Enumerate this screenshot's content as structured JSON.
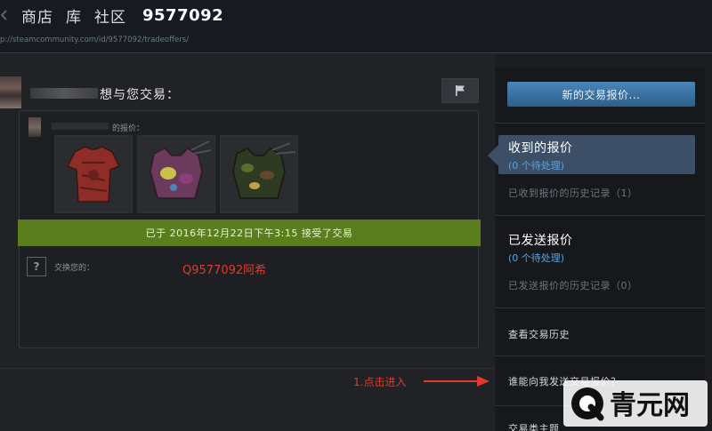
{
  "topbar": {
    "back_icon": "left-arrow-icon",
    "nav": [
      "商店",
      "库",
      "社区"
    ],
    "username": "9577092",
    "url": "p://steamcommunity.com/id/9577092/tradeoffers/"
  },
  "offer": {
    "title": "想与您交易：",
    "offer_label": "的报价：",
    "accepted_text": "已于 2016年12月22日下午3:15 接受了交易",
    "exchange_label": "交换您的：",
    "question_mark": "?",
    "watermark": "Q9577092阿希",
    "items": [
      {
        "icon": "red-shirt-icon"
      },
      {
        "icon": "purple-backpack-icon"
      },
      {
        "icon": "camo-backpack-icon"
      }
    ]
  },
  "annotation": {
    "text": "1.点击进入"
  },
  "sidebar": {
    "new_offer_button": "新的交易报价...",
    "received": {
      "title": "收到的报价",
      "pending": "(0 个待处理)",
      "history": "已收到报价的历史记录（1）"
    },
    "sent": {
      "title": "已发送报价",
      "pending": "(0 个待处理)",
      "history": "已发送报价的历史记录（0）"
    },
    "view_history": "查看交易历史",
    "who_can_send": "谁能向我发送交易报价？",
    "trade_theme_partial": "交易类主题"
  },
  "logo": {
    "text": "青元网"
  },
  "colors": {
    "accepted_bar": "#5a7e1d",
    "accent_blue": "#5ba3e0",
    "annotation_red": "#e23a2c",
    "button_blue": "#3f79aa"
  }
}
